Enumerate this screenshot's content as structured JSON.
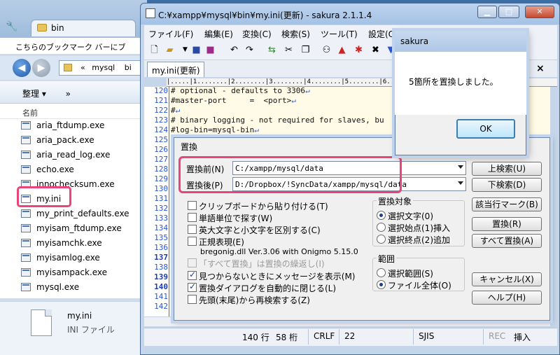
{
  "explorer": {
    "tab_title": "bin",
    "bookmark_bar_text": "こちらのブックマーク バーにブ",
    "address_parts": [
      "«",
      "mysql",
      "bi"
    ],
    "organize_label": "整理 ▾",
    "more_label": "»",
    "column_header": "名前",
    "files": [
      "aria_ftdump.exe",
      "aria_pack.exe",
      "aria_read_log.exe",
      "echo.exe",
      "innochecksum.exe",
      "my.ini",
      "my_print_defaults.exe",
      "myisam_ftdump.exe",
      "myisamchk.exe",
      "myisamlog.exe",
      "myisampack.exe",
      "mysql.exe"
    ],
    "status_name": "my.ini",
    "status_type": "INI ファイル"
  },
  "editor": {
    "title": "C:¥xampp¥mysql¥bin¥my.ini(更新) - sakura 2.1.1.4",
    "menu": [
      "ファイル(F)",
      "編集(E)",
      "変換(C)",
      "検索(S)",
      "ツール(T)",
      "設定(O)"
    ],
    "tab_label": "my.ini(更新)",
    "tab_close": "×",
    "ruler": "|.....|1........|2........|3........|4........|5........|6........|7........|8",
    "line_numbers": [
      "120",
      "121",
      "122",
      "123",
      "124",
      "125",
      "126",
      "127",
      "128",
      "129",
      "130",
      "131",
      "132",
      "133",
      "134",
      "135",
      "136",
      "137",
      "138",
      "139",
      "140",
      "141",
      "142",
      "143"
    ],
    "lines": [
      "# optional - defaults to 3306",
      "#master-port     =  <port>",
      "#",
      "# binary logging - not required for slaves, bu",
      "#log-bin=mysql-bin"
    ],
    "status": {
      "row": "140 行",
      "col": "58 桁",
      "eol": "CRLF",
      "code_point": "22",
      "encoding": "SJIS",
      "rec": "REC",
      "insert_mode": "挿入"
    }
  },
  "replace_dialog": {
    "title": "置換",
    "find_label": "置換前(N)",
    "find_value": "C:/xampp/mysql/data",
    "replace_label": "置換後(P)",
    "replace_value": "D:/Dropbox/!SyncData/xampp/mysql/data",
    "options": [
      {
        "label": "クリップボードから貼り付ける(T)",
        "checked": false
      },
      {
        "label": "単語単位で探す(W)",
        "checked": false
      },
      {
        "label": "英大文字と小文字を区別する(C)",
        "checked": false
      },
      {
        "label": "正規表現(E)",
        "checked": false
      }
    ],
    "regex_engine": "bregonig.dll Ver.3.06 with Onigmo 5.15.0",
    "undo_option": "「すべて置換」は置換の繰返し(I)",
    "options2": [
      {
        "label": "見つからないときにメッセージを表示(M)",
        "checked": true
      },
      {
        "label": "置換ダイアログを自動的に閉じる(L)",
        "checked": true
      },
      {
        "label": "先頭(末尾)から再検索する(Z)",
        "checked": false
      }
    ],
    "target_group": "置換対象",
    "target_options": [
      "選択文字(0)",
      "選択始点(1)挿入",
      "選択終点(2)追加"
    ],
    "range_group": "範囲",
    "range_options": [
      "選択範囲(S)",
      "ファイル全体(O)"
    ],
    "buttons": {
      "search_up": "上検索(U)",
      "search_down": "下検索(D)",
      "mark_all": "該当行マーク(B)",
      "replace": "置換(R)",
      "replace_all": "すべて置換(A)",
      "cancel": "キャンセル(X)",
      "help": "ヘルプ(H)"
    }
  },
  "message_box": {
    "title": "sakura",
    "message": "5箇所を置換しました。",
    "ok_label": "OK"
  },
  "colors": {
    "highlight": "#e8457a",
    "line_number": "#2a55d8",
    "editor_bg": "#fffbe6"
  }
}
